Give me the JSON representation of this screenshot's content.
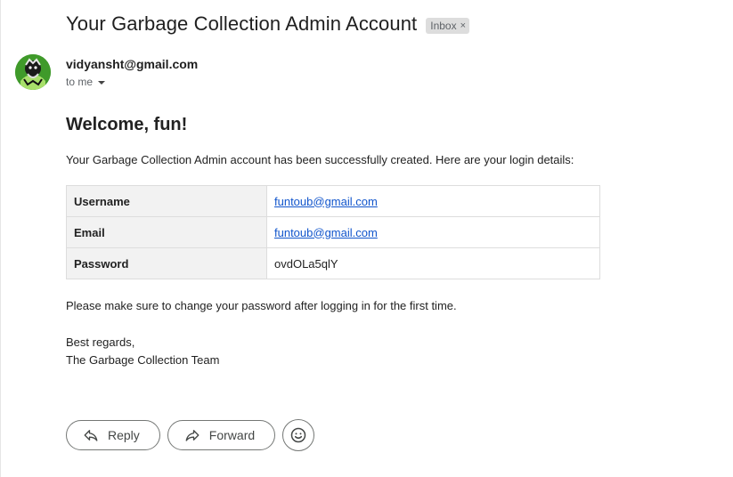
{
  "email": {
    "subject": "Your Garbage Collection Admin Account",
    "label": "Inbox",
    "label_close": "×",
    "sender": "vidyansht@gmail.com",
    "recipient": "to me"
  },
  "message": {
    "greeting": "Welcome, fun!",
    "intro": "Your Garbage Collection Admin account has been successfully created. Here are your login details:",
    "credentials": [
      {
        "key": "Username",
        "value": "funtoub@gmail.com",
        "is_link": true
      },
      {
        "key": "Email",
        "value": "funtoub@gmail.com",
        "is_link": true
      },
      {
        "key": "Password",
        "value": "ovdOLa5qlY",
        "is_link": false
      }
    ],
    "note": "Please make sure to change your password after logging in for the first time.",
    "closing": "Best regards,",
    "signature": "The Garbage Collection Team"
  },
  "actions": {
    "reply_label": "Reply",
    "forward_label": "Forward",
    "reply_icon": "reply-icon",
    "forward_icon": "forward-icon",
    "emoji_icon": "emoji-icon"
  },
  "colors": {
    "link": "#1155cc",
    "avatar_bg": "#3f9a2a",
    "label_bg": "#dddddd"
  }
}
